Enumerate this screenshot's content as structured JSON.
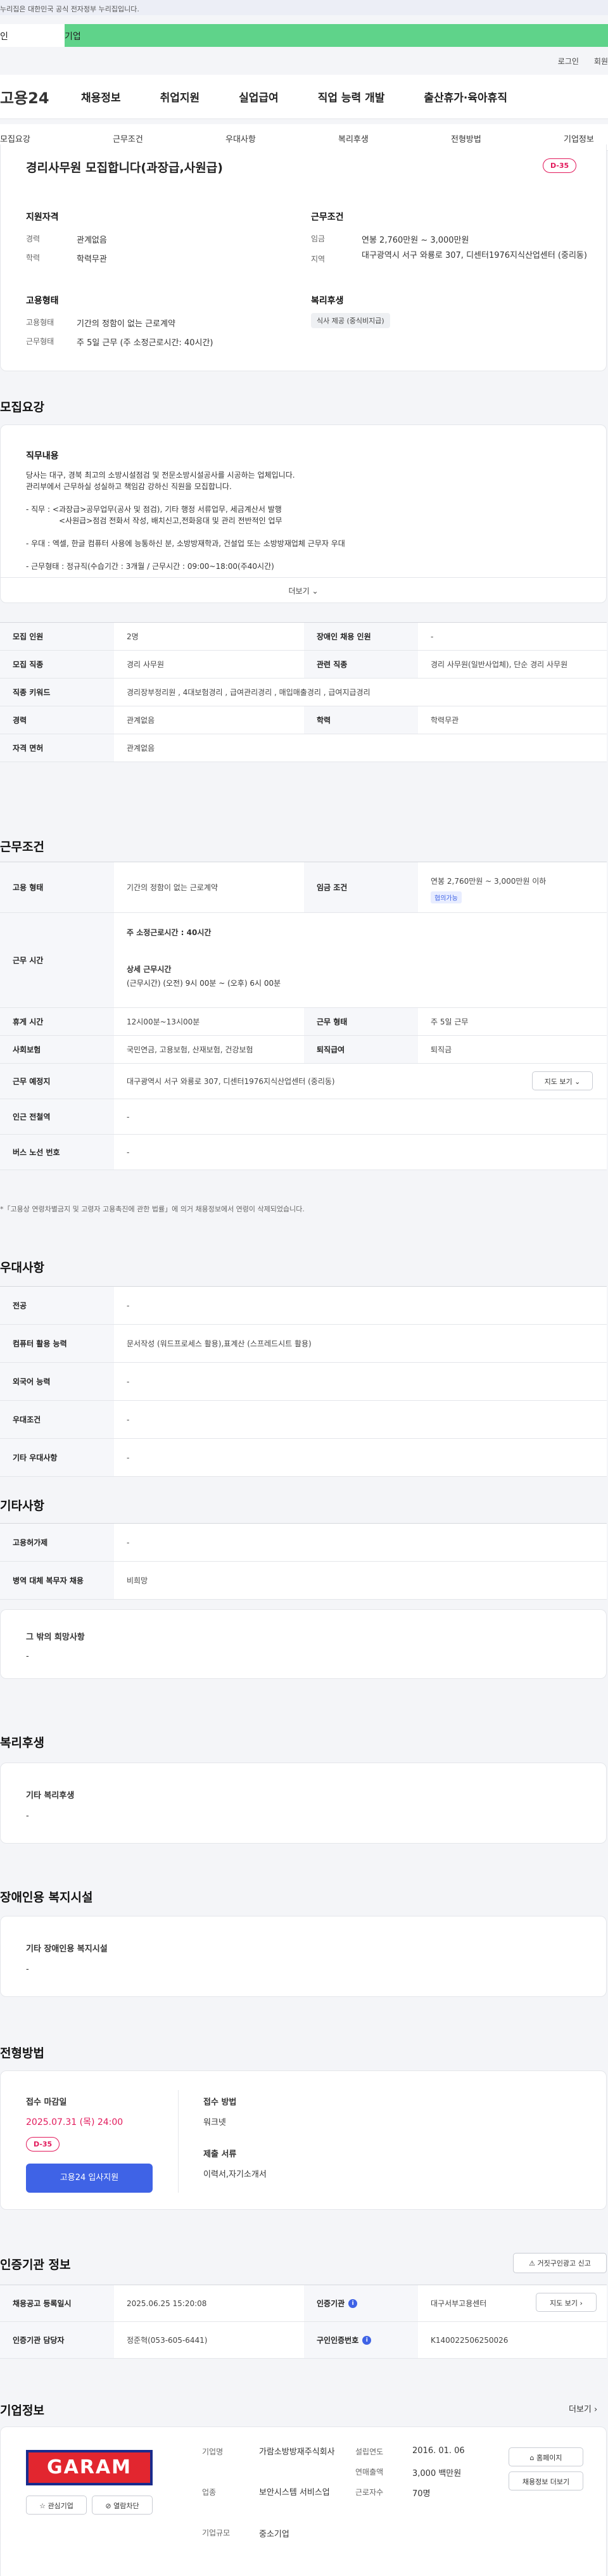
{
  "gov_banner": "누리집은 대한민국 공식 전자정부 누리집입니다.",
  "tabs": {
    "personal": "인",
    "company": "기업"
  },
  "utility": {
    "login": "로그인",
    "join": "회원"
  },
  "gnb": {
    "logo": "고용24",
    "items": [
      "채용정보",
      "취업지원",
      "실업급여",
      "직업 능력 개발",
      "출산휴가·육아휴직"
    ]
  },
  "subnav": [
    "모집요강",
    "근무조건",
    "우대사항",
    "복리후생",
    "전형방법",
    "기업정보"
  ],
  "summary": {
    "title": "경리사무원 모집합니다(과장급,사원급)",
    "dday": "D-35",
    "qual_title": "지원자격",
    "career_label": "경력",
    "career": "관계없음",
    "edu_label": "학력",
    "edu": "학력무관",
    "cond_title": "근무조건",
    "wage_label": "임금",
    "wage": "연봉 2,760만원 ~ 3,000만원",
    "loc_label": "지역",
    "loc": "대구광역시 서구 와룡로 307, 디센터1976지식산업센터 (중리동)",
    "emp_title": "고용형태",
    "emp_label": "고용형태",
    "emp": "기간의 정함이 없는 근로계약",
    "hours_label": "근무형태",
    "hours": "주 5일 근무 (주 소정근로시간: 40시간)",
    "welfare_title": "복리후생",
    "welfare_chip": "식사 제공 (중식비지급)"
  },
  "recruit": {
    "section": "모집요강",
    "job_title": "직무내용",
    "lines": [
      "당사는 대구, 경북 최고의 소방시설점검 및 전문소방시설공사를 시공하는 업체입니다.",
      "관리부에서 근무하실 성실하고 책임감 강하신 직원을 모집합니다.",
      "- 직무 : <과장급>공무업무(공사 및 점검), 기타 행정 서류업무, 세금계산서 발행",
      "<사원급>점검 전화서 작성, 배치신고,전화응대 및 관리 전반적인 업무",
      "- 우대 : 엑셀, 한글 컴퓨터 사용에 능통하신 분, 소방방재학과, 건설업 또는 소방방재업체 근무자 우대",
      "- 근무형태 : 정규직(수습기간 : 3개월 / 근무시간 : 09:00~18:00(주40시간)"
    ],
    "more": "더보기",
    "rows": [
      [
        "모집 인원",
        "2명",
        "장애인 채용 인원",
        "-"
      ],
      [
        "모집 직종",
        "경리 사무원",
        "관련 직종",
        "경리 사무원(일반사업체), 단순 경리 사무원"
      ],
      [
        "직종 키워드",
        "경리장부정리원 , 4대보험경리 , 급여관리경리 , 매입매출경리 , 급여지급경리",
        "",
        ""
      ],
      [
        "경력",
        "관계없음",
        "학력",
        "학력무관"
      ],
      [
        "자격 면허",
        "관계없음",
        "",
        ""
      ]
    ]
  },
  "work": {
    "section": "근무조건",
    "emp_type_label": "고용 형태",
    "emp_type": "기간의 정함이 없는 근로계약",
    "wage_label": "임금 조건",
    "wage": "연봉 2,760만원 ~ 3,000만원 이하",
    "nego": "협의가능",
    "hours_label": "근무 시간",
    "weekly": "주 소정근로시간 :",
    "weekly_val": "40시간",
    "detail_title": "상세 근무시간",
    "detail": "(근무시간) (오전) 9시 00분 ~ (오후) 6시 00분",
    "break_label": "휴게 시간",
    "break": "12시00분~13시00분",
    "form_label": "근무 형태",
    "form": "주 5일 근무",
    "ins_label": "사회보험",
    "ins": "국민연금, 고용보험, 산재보험, 건강보험",
    "ret_label": "퇴직급여",
    "ret": "퇴직금",
    "place_label": "근무 예정지",
    "place": "대구광역시 서구 와룡로 307, 디센터1976지식산업센터 (중리동)",
    "map": "지도 보기",
    "subway_label": "인근 전철역",
    "subway": "-",
    "bus_label": "버스 노선 번호",
    "bus": "-",
    "note": "*「고용상 연령차별금지 및 고령자 고용촉진에 관한 법률」에 의거 채용정보에서 연령이 삭제되었습니다."
  },
  "pref": {
    "section": "우대사항",
    "rows": [
      [
        "전공",
        "-"
      ],
      [
        "컴퓨터 활용 능력",
        "문서작성 (워드프로세스 활용),표계산 (스프레드시트 활용)"
      ],
      [
        "외국어 능력",
        "-"
      ],
      [
        "우대조건",
        "-"
      ],
      [
        "기타 우대사항",
        "-"
      ]
    ]
  },
  "etc": {
    "section": "기타사항",
    "rows": [
      [
        "고용허가제",
        "-"
      ],
      [
        "병역 대체 복무자 채용",
        "비희망"
      ]
    ],
    "wish_title": "그 밖의 희망사항",
    "wish": "-"
  },
  "benefit": {
    "section": "복리후생",
    "title": "기타 복리후생",
    "val": "-"
  },
  "disabled": {
    "section": "장애인용 복지시설",
    "title": "기타 장애인용 복지시설",
    "val": "-"
  },
  "screening": {
    "section": "전형방법",
    "deadline_title": "접수 마감일",
    "deadline": "2025.07.31 (목) 24:00",
    "dday": "D-35",
    "apply": "고용24 입사지원",
    "method_title": "접수 방법",
    "method": "워크넷",
    "docs_title": "제출 서류",
    "docs": "이력서,자기소개서"
  },
  "cert": {
    "section": "인증기관 정보",
    "report": "거짓구인광고 신고",
    "reg_label": "채용공고 등록일시",
    "reg": "2025.06.25 15:20:08",
    "org_label": "인증기관",
    "org": "대구서부고용센터",
    "map": "지도 보기",
    "mgr_label": "인증기관 담당자",
    "mgr": "정준혁(053-605-6441)",
    "num_label": "구인인증번호",
    "num": "K140022506250026"
  },
  "company": {
    "section": "기업정보",
    "more": "더보기",
    "logo": "GARAM",
    "fav": "관심기업",
    "block": "열람차단",
    "name_label": "기업명",
    "name": "가람소방방재주식회사",
    "ind_label": "업종",
    "ind": "보안시스템 서비스업",
    "size_label": "기업규모",
    "size": "중소기업",
    "est_label": "설립연도",
    "est": "2016. 01. 06",
    "sales_label": "연매출액",
    "sales": "3,000 백만원",
    "emp_label": "근로자수",
    "emp": "70명",
    "home": "홈페이지",
    "jobs": "채용정보 더보기"
  }
}
